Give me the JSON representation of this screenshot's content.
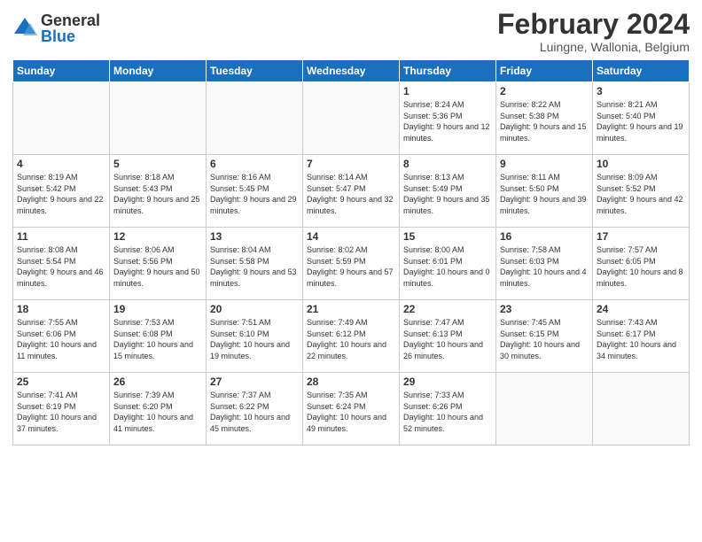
{
  "logo": {
    "general": "General",
    "blue": "Blue"
  },
  "title": "February 2024",
  "location": "Luingne, Wallonia, Belgium",
  "days_of_week": [
    "Sunday",
    "Monday",
    "Tuesday",
    "Wednesday",
    "Thursday",
    "Friday",
    "Saturday"
  ],
  "weeks": [
    [
      {
        "day": "",
        "info": ""
      },
      {
        "day": "",
        "info": ""
      },
      {
        "day": "",
        "info": ""
      },
      {
        "day": "",
        "info": ""
      },
      {
        "day": "1",
        "info": "Sunrise: 8:24 AM\nSunset: 5:36 PM\nDaylight: 9 hours\nand 12 minutes."
      },
      {
        "day": "2",
        "info": "Sunrise: 8:22 AM\nSunset: 5:38 PM\nDaylight: 9 hours\nand 15 minutes."
      },
      {
        "day": "3",
        "info": "Sunrise: 8:21 AM\nSunset: 5:40 PM\nDaylight: 9 hours\nand 19 minutes."
      }
    ],
    [
      {
        "day": "4",
        "info": "Sunrise: 8:19 AM\nSunset: 5:42 PM\nDaylight: 9 hours\nand 22 minutes."
      },
      {
        "day": "5",
        "info": "Sunrise: 8:18 AM\nSunset: 5:43 PM\nDaylight: 9 hours\nand 25 minutes."
      },
      {
        "day": "6",
        "info": "Sunrise: 8:16 AM\nSunset: 5:45 PM\nDaylight: 9 hours\nand 29 minutes."
      },
      {
        "day": "7",
        "info": "Sunrise: 8:14 AM\nSunset: 5:47 PM\nDaylight: 9 hours\nand 32 minutes."
      },
      {
        "day": "8",
        "info": "Sunrise: 8:13 AM\nSunset: 5:49 PM\nDaylight: 9 hours\nand 35 minutes."
      },
      {
        "day": "9",
        "info": "Sunrise: 8:11 AM\nSunset: 5:50 PM\nDaylight: 9 hours\nand 39 minutes."
      },
      {
        "day": "10",
        "info": "Sunrise: 8:09 AM\nSunset: 5:52 PM\nDaylight: 9 hours\nand 42 minutes."
      }
    ],
    [
      {
        "day": "11",
        "info": "Sunrise: 8:08 AM\nSunset: 5:54 PM\nDaylight: 9 hours\nand 46 minutes."
      },
      {
        "day": "12",
        "info": "Sunrise: 8:06 AM\nSunset: 5:56 PM\nDaylight: 9 hours\nand 50 minutes."
      },
      {
        "day": "13",
        "info": "Sunrise: 8:04 AM\nSunset: 5:58 PM\nDaylight: 9 hours\nand 53 minutes."
      },
      {
        "day": "14",
        "info": "Sunrise: 8:02 AM\nSunset: 5:59 PM\nDaylight: 9 hours\nand 57 minutes."
      },
      {
        "day": "15",
        "info": "Sunrise: 8:00 AM\nSunset: 6:01 PM\nDaylight: 10 hours\nand 0 minutes."
      },
      {
        "day": "16",
        "info": "Sunrise: 7:58 AM\nSunset: 6:03 PM\nDaylight: 10 hours\nand 4 minutes."
      },
      {
        "day": "17",
        "info": "Sunrise: 7:57 AM\nSunset: 6:05 PM\nDaylight: 10 hours\nand 8 minutes."
      }
    ],
    [
      {
        "day": "18",
        "info": "Sunrise: 7:55 AM\nSunset: 6:06 PM\nDaylight: 10 hours\nand 11 minutes."
      },
      {
        "day": "19",
        "info": "Sunrise: 7:53 AM\nSunset: 6:08 PM\nDaylight: 10 hours\nand 15 minutes."
      },
      {
        "day": "20",
        "info": "Sunrise: 7:51 AM\nSunset: 6:10 PM\nDaylight: 10 hours\nand 19 minutes."
      },
      {
        "day": "21",
        "info": "Sunrise: 7:49 AM\nSunset: 6:12 PM\nDaylight: 10 hours\nand 22 minutes."
      },
      {
        "day": "22",
        "info": "Sunrise: 7:47 AM\nSunset: 6:13 PM\nDaylight: 10 hours\nand 26 minutes."
      },
      {
        "day": "23",
        "info": "Sunrise: 7:45 AM\nSunset: 6:15 PM\nDaylight: 10 hours\nand 30 minutes."
      },
      {
        "day": "24",
        "info": "Sunrise: 7:43 AM\nSunset: 6:17 PM\nDaylight: 10 hours\nand 34 minutes."
      }
    ],
    [
      {
        "day": "25",
        "info": "Sunrise: 7:41 AM\nSunset: 6:19 PM\nDaylight: 10 hours\nand 37 minutes."
      },
      {
        "day": "26",
        "info": "Sunrise: 7:39 AM\nSunset: 6:20 PM\nDaylight: 10 hours\nand 41 minutes."
      },
      {
        "day": "27",
        "info": "Sunrise: 7:37 AM\nSunset: 6:22 PM\nDaylight: 10 hours\nand 45 minutes."
      },
      {
        "day": "28",
        "info": "Sunrise: 7:35 AM\nSunset: 6:24 PM\nDaylight: 10 hours\nand 49 minutes."
      },
      {
        "day": "29",
        "info": "Sunrise: 7:33 AM\nSunset: 6:26 PM\nDaylight: 10 hours\nand 52 minutes."
      },
      {
        "day": "",
        "info": ""
      },
      {
        "day": "",
        "info": ""
      }
    ]
  ]
}
